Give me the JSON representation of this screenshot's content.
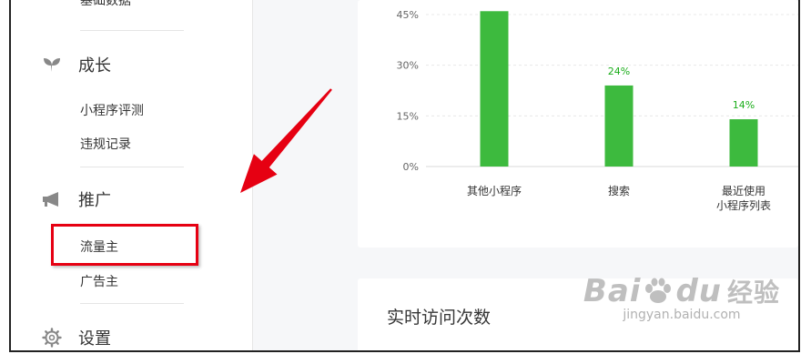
{
  "sidebar": {
    "top_cut_label": "基础数据",
    "groups": [
      {
        "label": "成长",
        "icon": "leaf-icon",
        "items": [
          "小程序评测",
          "违规记录"
        ]
      },
      {
        "label": "推广",
        "icon": "megaphone-icon",
        "items": [
          "流量主",
          "广告主"
        ]
      },
      {
        "label": "设置",
        "icon": "gear-icon",
        "items": []
      }
    ]
  },
  "chart_data": {
    "type": "bar",
    "categories": [
      "其他小程序",
      "搜索",
      "最近使用\n小程序列表"
    ],
    "values": [
      46,
      24,
      14
    ],
    "data_labels": [
      "",
      "24%",
      "14%"
    ],
    "y_ticks": [
      "0%",
      "15%",
      "30%",
      "45%"
    ],
    "ylim": [
      0,
      50
    ],
    "grid": true,
    "bar_color": "#3dba3e"
  },
  "card2": {
    "title": "实时访问次数"
  },
  "annotation": {
    "arrow_color": "#e60012",
    "highlight_color": "#e60012"
  },
  "watermark": {
    "logo": "Bai",
    "logo2": "du",
    "brand": "经验",
    "url": "jingyan.baidu.com"
  }
}
